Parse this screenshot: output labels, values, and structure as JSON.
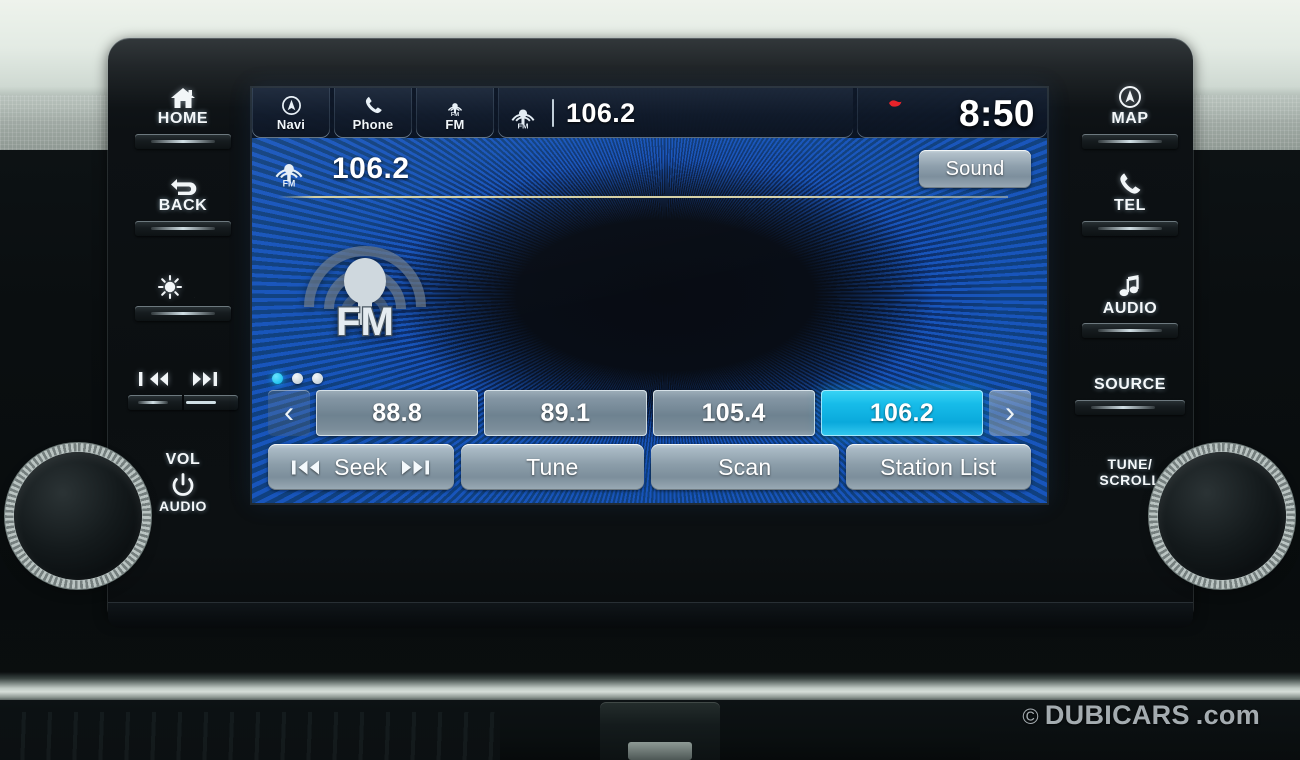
{
  "device": {
    "name": "Honda Display Audio head unit",
    "accent_cyan": "#17bce9",
    "button_gray": "#8b9da9"
  },
  "hard_buttons": {
    "left": [
      {
        "label": "HOME",
        "icon": "home-icon"
      },
      {
        "label": "BACK",
        "icon": "back-arrow-icon"
      },
      {
        "label": "",
        "icon": "brightness-day-night-icon"
      },
      {
        "label": "",
        "icon": "track-prev-next-icon"
      },
      {
        "label_top": "VOL",
        "label_bottom": "AUDIO",
        "icon": "power-icon"
      }
    ],
    "right": [
      {
        "label": "MAP",
        "icon": "map-pin-icon"
      },
      {
        "label": "TEL",
        "icon": "phone-icon"
      },
      {
        "label": "AUDIO",
        "icon": "music-note-icon"
      },
      {
        "label": "SOURCE",
        "icon": ""
      },
      {
        "label_top": "TUNE/",
        "label_bottom": "SCROLL",
        "icon": ""
      }
    ]
  },
  "status_bar": {
    "tabs": [
      {
        "label": "Navi",
        "icon": "navigation-arrow-icon"
      },
      {
        "label": "Phone",
        "icon": "phone-handset-icon"
      },
      {
        "label": "FM",
        "icon": "fm-radio-icon"
      }
    ],
    "now_playing": {
      "icon": "fm-radio-icon",
      "frequency": "106.2"
    },
    "alert_icon": "red-alert-icon",
    "clock": "8:50"
  },
  "source_bar": {
    "icon": "fm-radio-icon",
    "frequency": "106.2",
    "sound_button": "Sound"
  },
  "artwork": {
    "icon": "fm-radio-large-icon",
    "label": "FM"
  },
  "pager": {
    "total_pages": 3,
    "active_page": 1,
    "prev_label": "‹",
    "next_label": "›"
  },
  "presets": [
    {
      "value": "88.8",
      "selected": false
    },
    {
      "value": "89.1",
      "selected": false
    },
    {
      "value": "105.4",
      "selected": false
    },
    {
      "value": "106.2",
      "selected": true
    }
  ],
  "controls": {
    "seek": "Seek",
    "seek_prev_icon": "skip-back-icon",
    "seek_next_icon": "skip-forward-icon",
    "tune": "Tune",
    "scan": "Scan",
    "station_list": "Station List"
  },
  "watermark": {
    "copyright": "©",
    "brand": "DUBICARS",
    "tld": ".com"
  }
}
